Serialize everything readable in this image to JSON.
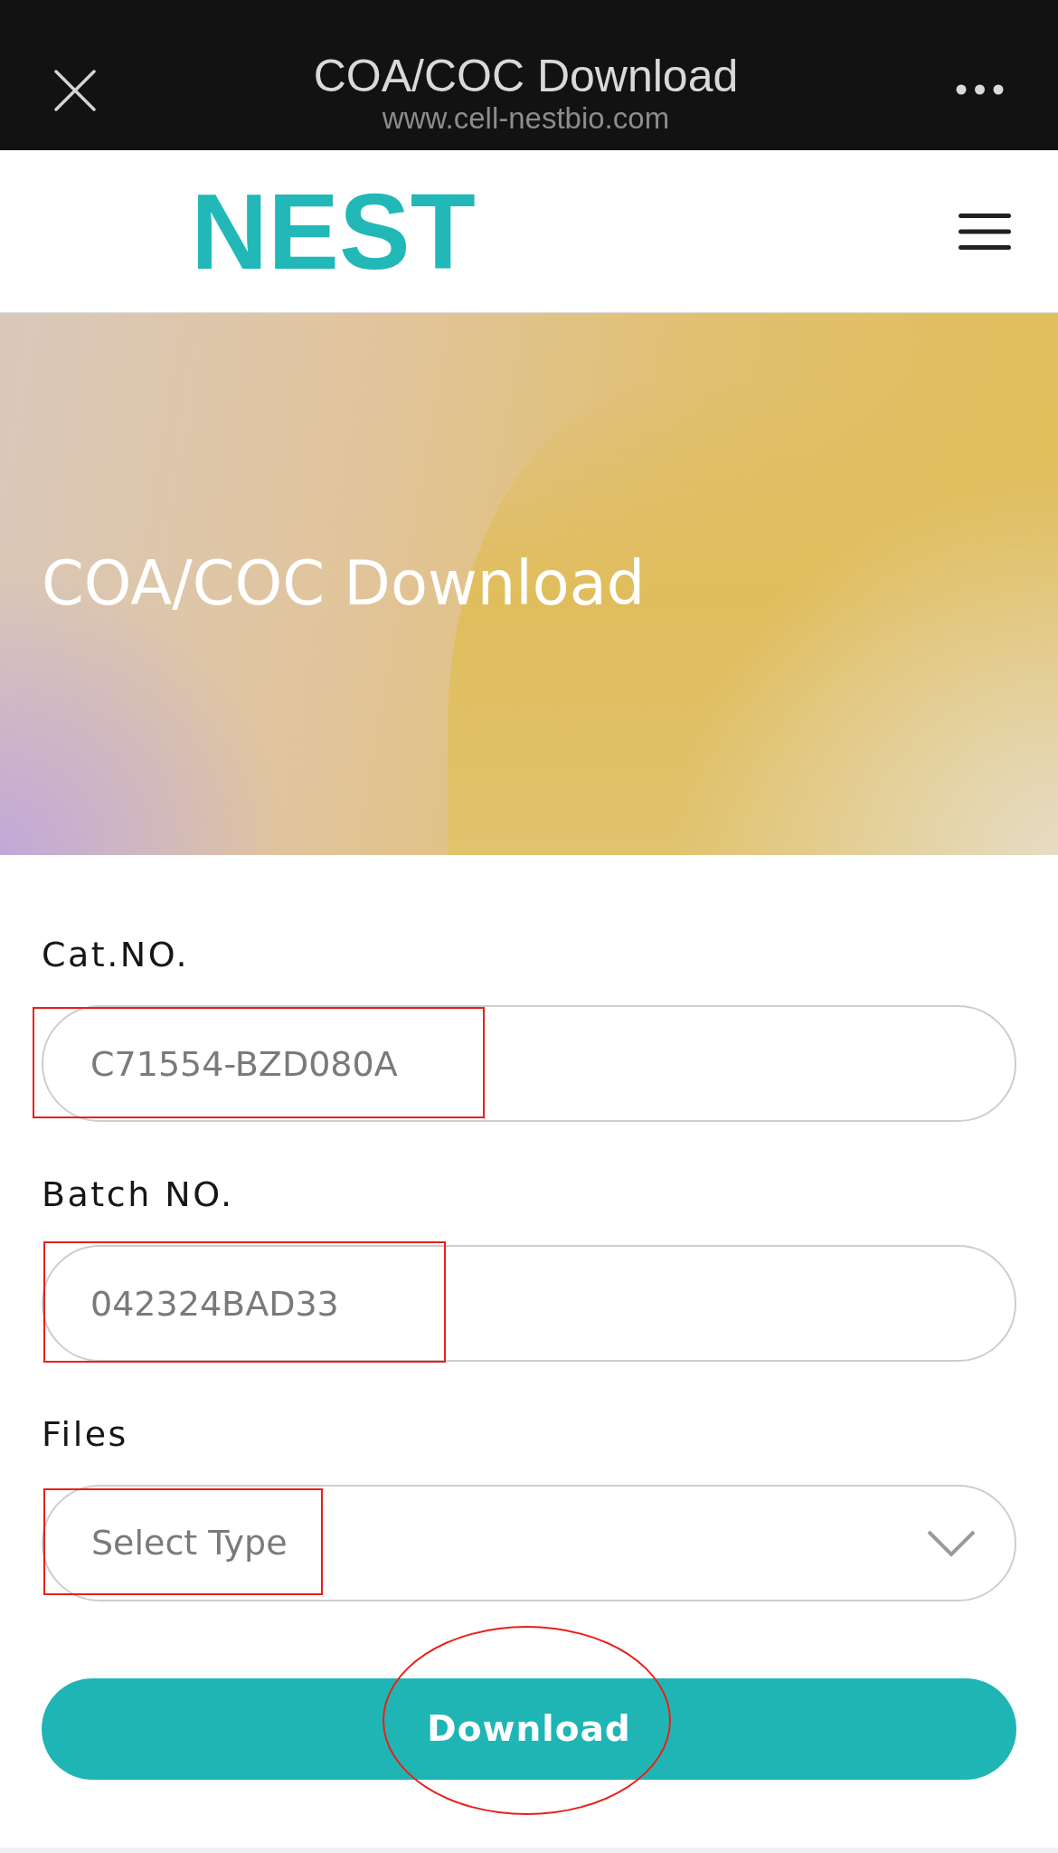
{
  "browser_bar": {
    "title": "COA/COC Download",
    "url": "www.cell-nestbio.com"
  },
  "header": {
    "logo": "NEST"
  },
  "hero": {
    "title": "COA/COC Download"
  },
  "form": {
    "fields": [
      {
        "kind": "text",
        "label": "Cat.NO.",
        "value": "C71554-BZD080A",
        "highlighted": true
      },
      {
        "kind": "text",
        "label": "Batch NO.",
        "value": "042324BAD33",
        "highlighted": true
      },
      {
        "kind": "select",
        "label": "Files",
        "placeholder": "Select Type",
        "highlighted": true
      }
    ],
    "submit": {
      "label": "Download",
      "circled": true
    }
  }
}
